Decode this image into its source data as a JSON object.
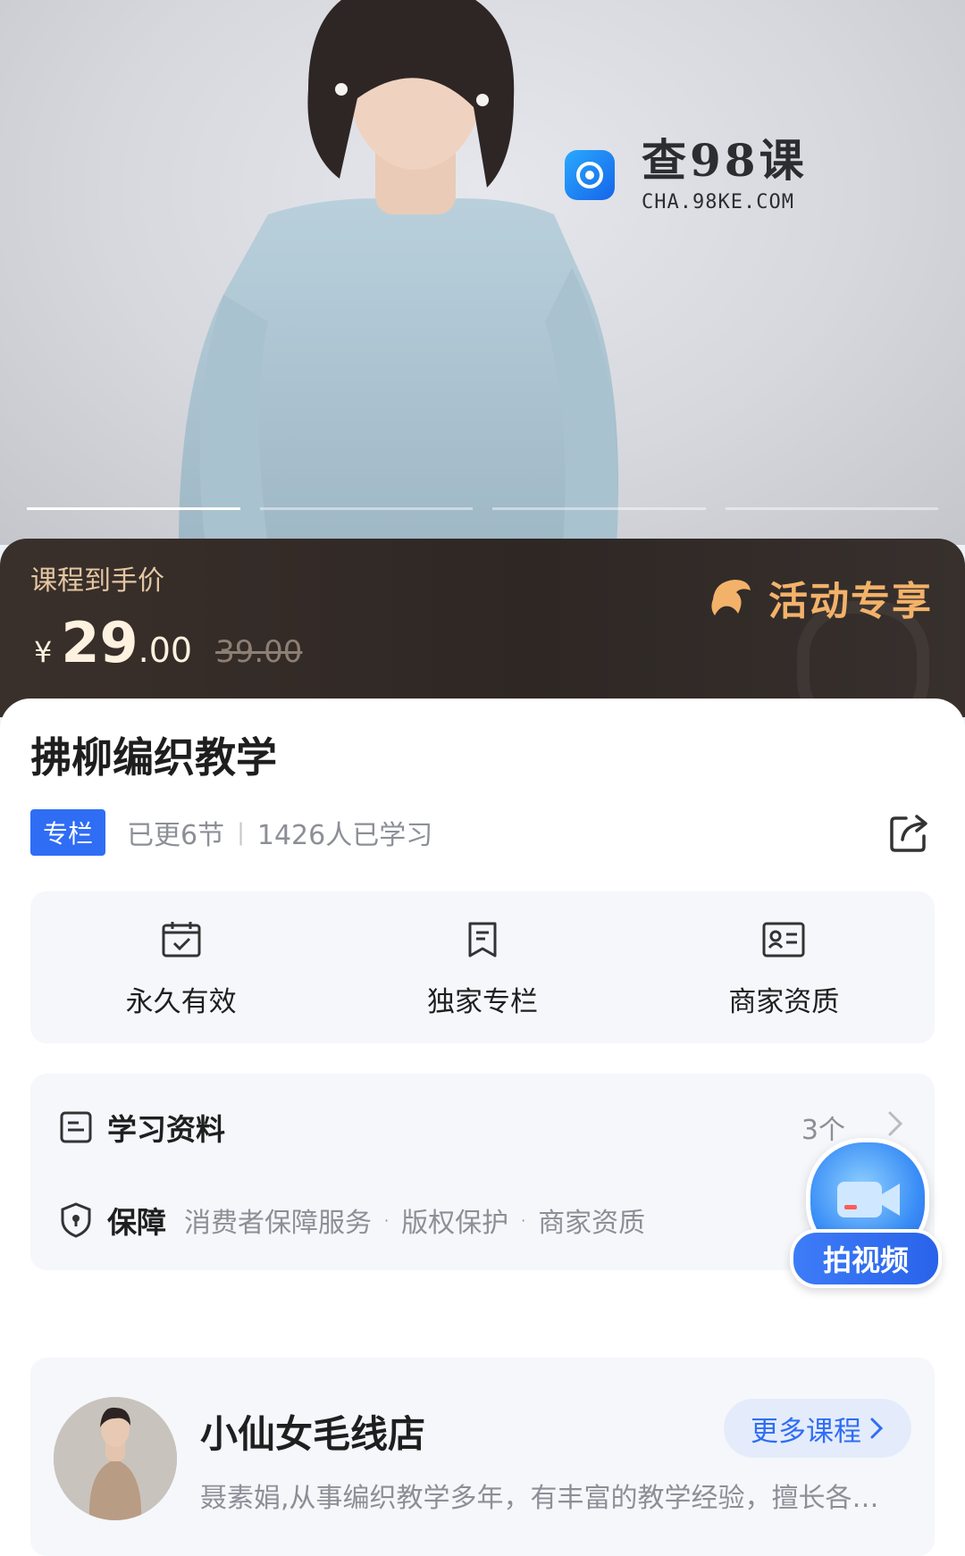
{
  "hero": {
    "watermark_title": "查98课",
    "watermark_sub": "CHA.98KE.COM",
    "slides_total": 4,
    "slide_active": 1
  },
  "price": {
    "label": "课程到手价",
    "currency": "¥",
    "integer": "29",
    "decimal": ".00",
    "original": "39.00",
    "promo": "活动专享"
  },
  "course": {
    "title": "拂柳编织教学",
    "tag": "专栏",
    "updated": "已更6节",
    "learners": "1426人已学习"
  },
  "features": [
    {
      "label": "永久有效",
      "icon": "calendar-check-icon"
    },
    {
      "label": "独家专栏",
      "icon": "bookmark-icon"
    },
    {
      "label": "商家资质",
      "icon": "id-card-icon"
    }
  ],
  "materials": {
    "title": "学习资料",
    "count": "3个"
  },
  "guarantee": {
    "title": "保障",
    "items": [
      "消费者保障服务",
      "版权保护",
      "商家资质"
    ]
  },
  "video_button": {
    "label": "拍视频"
  },
  "shop": {
    "name": "小仙女毛线店",
    "description": "聂素娟,从事编织教学多年，有丰富的教学经验，擅长各种编织技法",
    "more_label": "更多课程"
  },
  "colors": {
    "accent": "#2f6df5",
    "price_bar": "#2e2724",
    "promo": "#f3b26a"
  }
}
